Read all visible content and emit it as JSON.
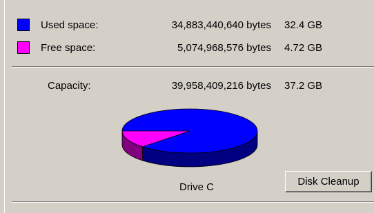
{
  "used": {
    "label": "Used space:",
    "bytes": "34,883,440,640 bytes",
    "gb": "32.4 GB",
    "color": "#0000ff"
  },
  "free": {
    "label": "Free space:",
    "bytes": "5,074,968,576 bytes",
    "gb": "4.72 GB",
    "color": "#ff00ff"
  },
  "capacity": {
    "label": "Capacity:",
    "bytes": "39,958,409,216 bytes",
    "gb": "37.2 GB"
  },
  "drive_label": "Drive C",
  "cleanup_button": "Disk Cleanup",
  "chart_data": {
    "type": "pie",
    "slices": [
      {
        "name": "Used space",
        "value": 34883440640,
        "color": "#0000ff",
        "shadow": "#000080"
      },
      {
        "name": "Free space",
        "value": 5074968576,
        "color": "#ff00ff",
        "shadow": "#800080"
      }
    ]
  }
}
